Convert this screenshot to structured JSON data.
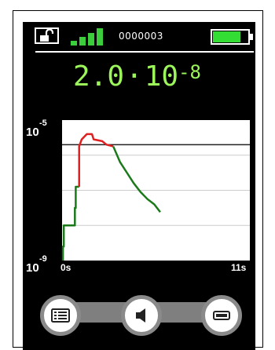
{
  "header": {
    "device_id": "0000003",
    "signal_bars": 4,
    "battery_level": 0.8
  },
  "reading": {
    "mantissa": "2.0",
    "operator": "·",
    "base": "10",
    "exponent": "-8"
  },
  "chart_data": {
    "type": "line",
    "xlabel": "",
    "ylabel": "",
    "x_tick_labels": [
      "0s",
      "11s"
    ],
    "y_tick_labels": [
      {
        "base": "10",
        "exp": "-5"
      },
      {
        "base": "10",
        "exp": "-9"
      }
    ],
    "xlim": [
      0,
      11
    ],
    "ylim_exp": [
      -9,
      -5
    ],
    "y_scale": "log",
    "grid": true,
    "threshold_exp": -5.7,
    "colors": {
      "below": "#1a7a1a",
      "above": "#e02020",
      "threshold": "#222222",
      "grid": "#cccccc"
    },
    "segments": [
      {
        "color": "below",
        "points": [
          [
            0.05,
            -9.0
          ],
          [
            0.05,
            -8.6
          ],
          [
            0.1,
            -8.6
          ],
          [
            0.1,
            -8.0
          ],
          [
            0.75,
            -8.0
          ],
          [
            0.75,
            -7.5
          ],
          [
            0.8,
            -7.5
          ],
          [
            0.8,
            -6.9
          ],
          [
            1.0,
            -6.9
          ]
        ]
      },
      {
        "color": "above",
        "points": [
          [
            1.0,
            -6.9
          ],
          [
            1.0,
            -5.75
          ],
          [
            1.15,
            -5.55
          ],
          [
            1.45,
            -5.4
          ],
          [
            1.75,
            -5.4
          ],
          [
            1.85,
            -5.55
          ],
          [
            2.35,
            -5.6
          ],
          [
            2.6,
            -5.7
          ],
          [
            3.0,
            -5.75
          ]
        ]
      },
      {
        "color": "below",
        "points": [
          [
            3.0,
            -5.75
          ],
          [
            3.4,
            -6.2
          ],
          [
            3.8,
            -6.5
          ],
          [
            4.2,
            -6.8
          ],
          [
            4.6,
            -7.05
          ],
          [
            5.0,
            -7.25
          ],
          [
            5.4,
            -7.4
          ],
          [
            5.75,
            -7.62
          ]
        ]
      }
    ]
  },
  "nav": {
    "colors": {
      "bar": "#7f7f7f",
      "ring": "#8a8a8a",
      "icon": "#222222"
    },
    "buttons": [
      {
        "name": "list",
        "icon": "list-icon"
      },
      {
        "name": "speaker",
        "icon": "speaker-icon"
      },
      {
        "name": "display",
        "icon": "display-icon"
      }
    ]
  }
}
